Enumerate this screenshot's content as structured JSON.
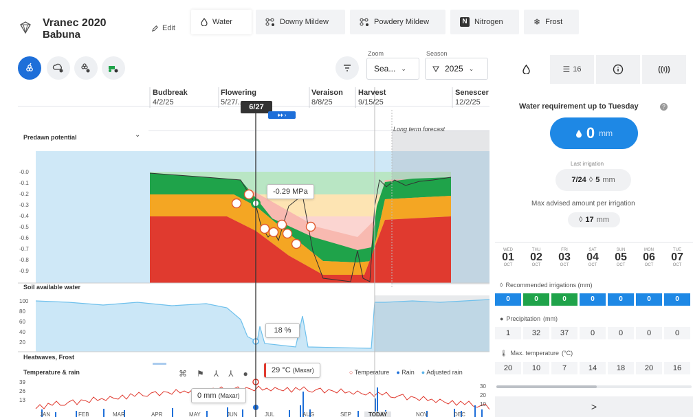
{
  "header": {
    "title": "Vranec 2020",
    "subtitle": "Babuna",
    "edit_label": "Edit",
    "tabs": [
      {
        "label": "Water",
        "icon": "droplet-icon",
        "active": true
      },
      {
        "label": "Downy Mildew",
        "icon": "disease-icon"
      },
      {
        "label": "Powdery Mildew",
        "icon": "disease-icon"
      },
      {
        "label": "Nitrogen",
        "icon": "nitrogen-icon",
        "badge": "N"
      },
      {
        "label": "Frost",
        "icon": "snowflake-icon"
      }
    ]
  },
  "toolbar": {
    "zoom_label": "Zoom",
    "zoom_value": "Sea...",
    "season_label": "Season",
    "season_value": "2025"
  },
  "chart": {
    "stages": [
      {
        "name": "Budbreak",
        "date": "4/2/25"
      },
      {
        "name": "Flowering",
        "date": "5/27/..."
      },
      {
        "name": "Veraison",
        "date": "8/8/25"
      },
      {
        "name": "Harvest",
        "date": "9/15/25"
      },
      {
        "name": "Senescer",
        "date": "12/2/25"
      }
    ],
    "cursor_date": "6/27",
    "long_term_forecast": "Long term forecast",
    "predawn_label": "Predawn potential",
    "predawn_ticks": [
      "-0.0",
      "-0.1",
      "-0.2",
      "-0.3",
      "-0.4",
      "-0.5",
      "-0.6",
      "-0.7",
      "-0.8",
      "-0.9"
    ],
    "predawn_tooltip": "-0.29 MPa",
    "soil_label": "Soil available water",
    "soil_ticks": [
      "100",
      "80",
      "60",
      "40",
      "20"
    ],
    "soil_tooltip": "18 %",
    "heatwave_label": "Heatwaves, Frost",
    "temp_label": "Temperature & rain",
    "temp_ticks": [
      "39",
      "26",
      "13"
    ],
    "rain_ticks": [
      "30",
      "20",
      "10"
    ],
    "temp_tooltip": "29 °C",
    "temp_tooltip_source": "(Maxar)",
    "rain_tooltip": "0 mm",
    "rain_tooltip_source": "(Maxar)",
    "legend": [
      "Temperature",
      "Rain",
      "Adjusted rain"
    ],
    "months": [
      "JAN",
      "FEB",
      "MAR",
      "APR",
      "MAY",
      "JUN",
      "JUL",
      "AUG",
      "SEP",
      "TODAY",
      "NOV",
      "DEC"
    ],
    "colors": {
      "red": "#e03a2f",
      "orange": "#f4a623",
      "green": "#1fa34a",
      "sky": "#cfe8f7",
      "blue": "#1e6fd9"
    }
  },
  "chart_data": {
    "type": "area",
    "title": "Predawn potential",
    "ylabel": "MPa",
    "ylim": [
      -0.95,
      0.05
    ],
    "series": [
      {
        "name": "Predawn potential",
        "x": [
          "4/2",
          "4/20",
          "5/10",
          "5/27",
          "6/10",
          "6/27",
          "7/15",
          "8/1",
          "8/8",
          "8/25",
          "9/10",
          "9/15",
          "10/1",
          "10/15",
          "11/1"
        ],
        "values": [
          -0.05,
          -0.08,
          -0.1,
          -0.2,
          -0.29,
          -0.29,
          -0.45,
          -0.55,
          -0.65,
          -0.85,
          -0.92,
          -0.05,
          -0.05,
          -0.05,
          -0.05
        ]
      }
    ]
  },
  "right_panel": {
    "tabs": [
      {
        "icon": "droplet-icon",
        "label": ""
      },
      {
        "icon": "list-icon",
        "label": "16"
      },
      {
        "icon": "info-icon",
        "label": ""
      },
      {
        "icon": "signal-icon",
        "label": ""
      }
    ],
    "water_requirement_label": "Water requirement up to Tuesday",
    "water_value": "0",
    "water_unit": "mm",
    "last_irrigation_label": "Last irrigation",
    "last_irrigation_date": "7/24",
    "last_irrigation_value": "5",
    "last_irrigation_unit": "mm",
    "max_advised_label": "Max advised amount per irrigation",
    "max_advised_value": "17",
    "max_advised_unit": "mm",
    "days": [
      {
        "name": "WED",
        "num": "01",
        "month": "OCT"
      },
      {
        "name": "THU",
        "num": "02",
        "month": "OCT"
      },
      {
        "name": "FRI",
        "num": "03",
        "month": "OCT"
      },
      {
        "name": "SAT",
        "num": "04",
        "month": "OCT"
      },
      {
        "name": "SUN",
        "num": "05",
        "month": "OCT"
      },
      {
        "name": "MON",
        "num": "06",
        "month": "OCT"
      },
      {
        "name": "TUE",
        "num": "07",
        "month": "OCT"
      }
    ],
    "recommended_label": "Recommended irrigations (mm)",
    "recommended": [
      "0",
      "0",
      "0",
      "0",
      "0",
      "0",
      "0"
    ],
    "precip_label": "Precipitation",
    "precip_unit": "(mm)",
    "precip": [
      "1",
      "32",
      "37",
      "0",
      "0",
      "0",
      "0"
    ],
    "maxtemp_label": "Max. temperature",
    "maxtemp_unit": "(°C)",
    "maxtemp": [
      "20",
      "10",
      "7",
      "14",
      "18",
      "20",
      "16"
    ],
    "next_label": ">"
  }
}
